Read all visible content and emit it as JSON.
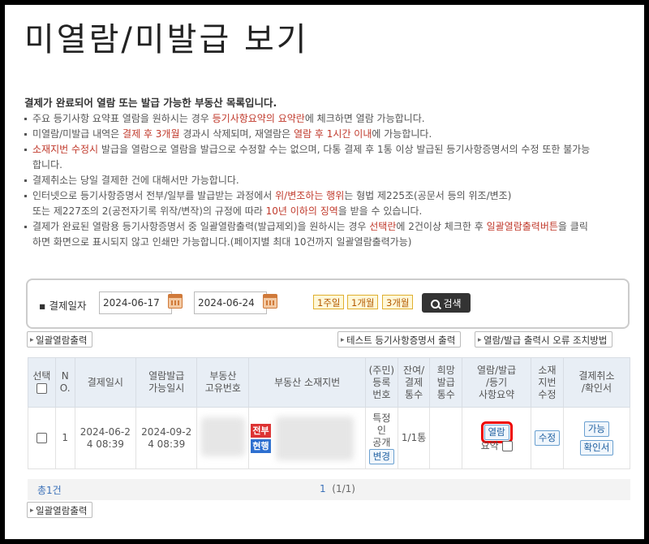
{
  "page_title": "미열람/미발급 보기",
  "intro": {
    "headline": "결제가 완료되어 열람 또는 발급 가능한 부동산 목록입니다.",
    "b1_a": "주요 등기사항 요약표 열람을 원하시는 경우 ",
    "b1_red": "등기사항요약의 요약란",
    "b1_b": "에 체크하면 열람 가능합니다.",
    "b2_a": "미열람/미발급 내역은 ",
    "b2_red1": "결제 후 3개월",
    "b2_b": " 경과시 삭제되며, 재열람은 ",
    "b2_red2": "열람 후 1시간 이내",
    "b2_c": "에 가능합니다.",
    "b3_red": "소재지번 수정시",
    "b3_a": " 발급을 열람으로 열람을 발급으로 수정할 수는 없으며, 다통 결제 후 1통 이상 발급된 등기사항증명서의 수정 또한 불가능",
    "b3_cont": "합니다.",
    "b4": "결제취소는 당일 결제한 건에 대해서만 가능합니다.",
    "b5_a": "인터넷으로 등기사항증명서 전부/일부를 발급받는 과정에서 ",
    "b5_red": "위/변조하는 행위",
    "b5_b": "는 형법 제225조(공문서 등의 위조/변조)",
    "b5_cont_a": "또는 제227조의 2(공전자기록 위작/변작)의 규정에 따라 ",
    "b5_cont_red": "10년 이하의 징역",
    "b5_cont_b": "을 받을 수 있습니다.",
    "b6_a": "결제가 완료된 열람용 등기사항증명서 중 일괄열람출력(발급제외)을 원하시는 경우 ",
    "b6_red1": "선택란",
    "b6_b": "에 2건이상 체크한 후 ",
    "b6_red2": "일괄열람출력버튼",
    "b6_c": "을 클릭",
    "b6_cont": "하면 화면으로 표시되지 않고 인쇄만 가능합니다.(페이지별 최대 10건까지 일괄열람출력가능)"
  },
  "filter": {
    "label": "결제일자",
    "start_date": "2024-06-17",
    "tilde": "~",
    "end_date": "2024-06-24",
    "week1": "1주일",
    "month1": "1개월",
    "month3": "3개월",
    "search": "검색"
  },
  "toolbar": {
    "batch_print": "일괄열람출력",
    "test_print": "테스트 등기사항증명서 출력",
    "error_guide": "열람/발급 출력시 오류 조치방법"
  },
  "table": {
    "headers": {
      "select": "선택",
      "no_1": "N",
      "no_2": "O.",
      "pay_date": "결제일시",
      "issue_date_1": "열람발급",
      "issue_date_2": "가능일시",
      "prop_id_1": "부동산",
      "prop_id_2": "고유번호",
      "address": "부동산 소재지번",
      "resident_1": "(주민)",
      "resident_2": "등록",
      "resident_3": "번호",
      "remain_1": "잔여/",
      "remain_2": "결제",
      "remain_3": "통수",
      "want_1": "희망",
      "want_2": "발급",
      "want_3": "통수",
      "view_1": "열람/발급",
      "view_2": "/등기",
      "view_3": "사항요약",
      "loc_1": "소재",
      "loc_2": "지번",
      "loc_3": "수정",
      "cancel_1": "결제취소",
      "cancel_2": "/확인서"
    },
    "row": {
      "no": "1",
      "pay_date_1": "2024-06-2",
      "pay_date_2": "4 08:39",
      "issue_date_1": "2024-09-2",
      "issue_date_2": "4 08:39",
      "tag_all": "전부",
      "tag_current": "현행",
      "resident_1": "특정",
      "resident_2": "인",
      "resident_3": "공개",
      "change": "변경",
      "remain": "1/1통",
      "view": "열람",
      "summary": "요약",
      "modify": "수정",
      "possible": "가능",
      "certificate": "확인서"
    }
  },
  "footer": {
    "total": "총1건",
    "page_current": "1",
    "page_info": "(1/1)"
  }
}
